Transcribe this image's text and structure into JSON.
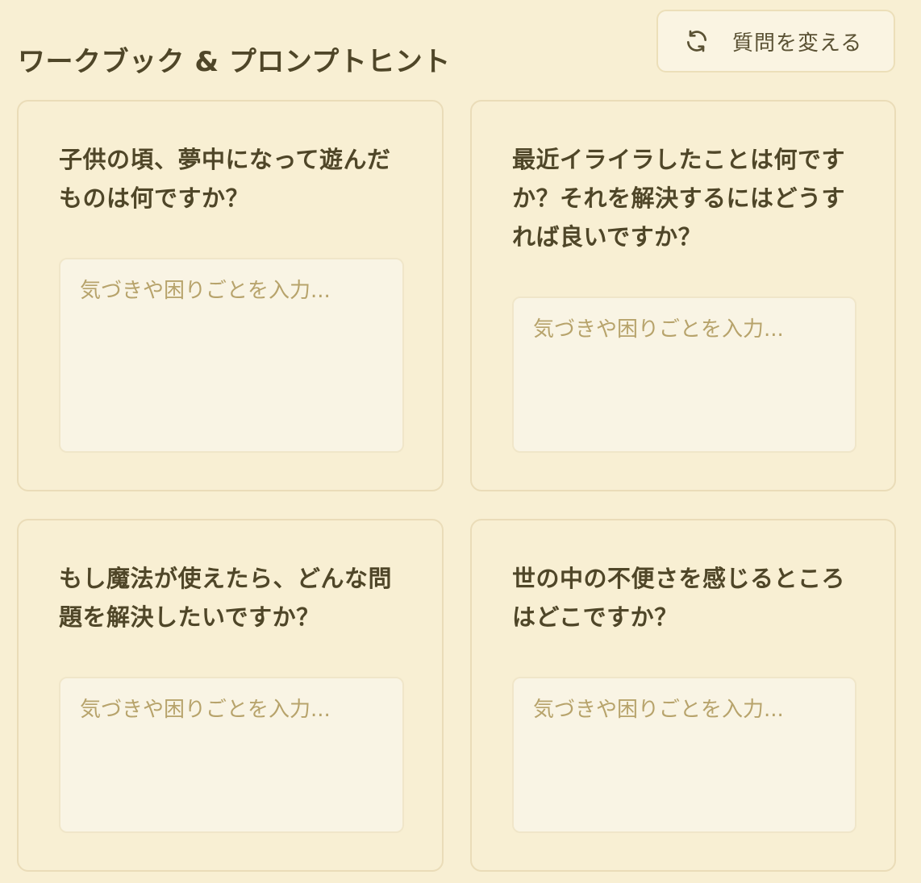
{
  "header": {
    "title": "ワークブック & プロンプトヒント",
    "change_button_label": "質問を変える"
  },
  "icons": {
    "refresh": "refresh-icon"
  },
  "colors": {
    "background": "#f8efd3",
    "text": "#4f4628",
    "placeholder": "#b7a36b"
  },
  "cards": [
    {
      "question": "子供の頃、夢中になって遊んだものは何ですか？",
      "placeholder": "気づきや困りごとを入力..."
    },
    {
      "question": "最近イライラしたことは何ですか？それを解決するにはどうすれば良いですか？",
      "placeholder": "気づきや困りごとを入力..."
    },
    {
      "question": "もし魔法が使えたら、どんな問題を解決したいですか？",
      "placeholder": "気づきや困りごとを入力..."
    },
    {
      "question": "世の中の不便さを感じるところはどこですか？",
      "placeholder": "気づきや困りごとを入力..."
    }
  ]
}
